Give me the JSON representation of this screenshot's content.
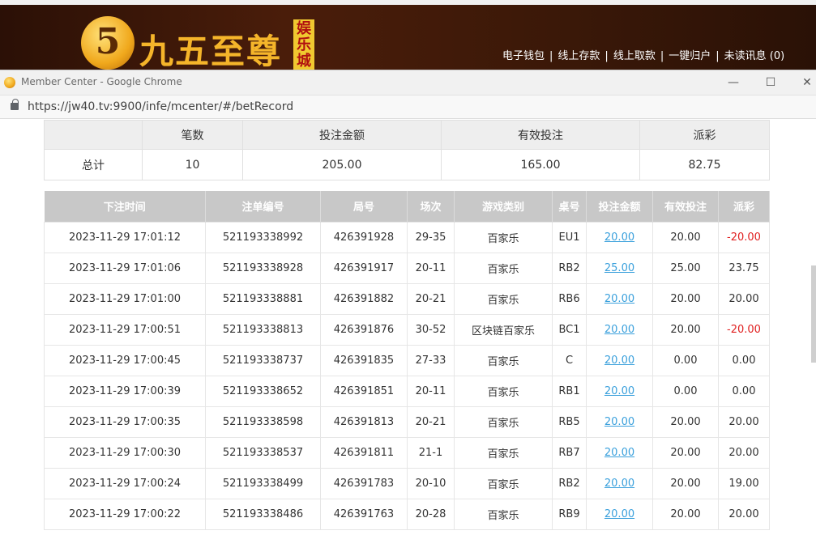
{
  "site": {
    "logo_glyph": "5",
    "logo_text": "九五至尊",
    "logo_badge": "娱乐城",
    "nav": [
      "电子钱包",
      "线上存款",
      "线上取款",
      "一键归户",
      "未读讯息 (0)"
    ],
    "nav_sep": "|"
  },
  "window": {
    "title": "Member Center - Google Chrome",
    "url": "https://jw40.tv:9900/infe/mcenter/#/betRecord",
    "min_label": "—",
    "max_label": "☐",
    "close_label": "✕"
  },
  "summary": {
    "headers": [
      "",
      "笔数",
      "投注金额",
      "有效投注",
      "派彩"
    ],
    "row": [
      "总计",
      "10",
      "205.00",
      "165.00",
      "82.75"
    ]
  },
  "records": {
    "headers": [
      "下注时间",
      "注单编号",
      "局号",
      "场次",
      "游戏类别",
      "桌号",
      "投注金额",
      "有效投注",
      "派彩"
    ],
    "rows": [
      [
        "2023-11-29 17:01:12",
        "521193338992",
        "426391928",
        "29-35",
        "百家乐",
        "EU1",
        "20.00",
        "20.00",
        "-20.00"
      ],
      [
        "2023-11-29 17:01:06",
        "521193338928",
        "426391917",
        "20-11",
        "百家乐",
        "RB2",
        "25.00",
        "25.00",
        "23.75"
      ],
      [
        "2023-11-29 17:01:00",
        "521193338881",
        "426391882",
        "20-21",
        "百家乐",
        "RB6",
        "20.00",
        "20.00",
        "20.00"
      ],
      [
        "2023-11-29 17:00:51",
        "521193338813",
        "426391876",
        "30-52",
        "区块链百家乐",
        "BC1",
        "20.00",
        "20.00",
        "-20.00"
      ],
      [
        "2023-11-29 17:00:45",
        "521193338737",
        "426391835",
        "27-33",
        "百家乐",
        "C",
        "20.00",
        "0.00",
        "0.00"
      ],
      [
        "2023-11-29 17:00:39",
        "521193338652",
        "426391851",
        "20-11",
        "百家乐",
        "RB1",
        "20.00",
        "0.00",
        "0.00"
      ],
      [
        "2023-11-29 17:00:35",
        "521193338598",
        "426391813",
        "20-21",
        "百家乐",
        "RB5",
        "20.00",
        "20.00",
        "20.00"
      ],
      [
        "2023-11-29 17:00:30",
        "521193338537",
        "426391811",
        "21-1",
        "百家乐",
        "RB7",
        "20.00",
        "20.00",
        "20.00"
      ],
      [
        "2023-11-29 17:00:24",
        "521193338499",
        "426391783",
        "20-10",
        "百家乐",
        "RB2",
        "20.00",
        "20.00",
        "19.00"
      ],
      [
        "2023-11-29 17:00:22",
        "521193338486",
        "426391763",
        "20-28",
        "百家乐",
        "RB9",
        "20.00",
        "20.00",
        "20.00"
      ]
    ]
  },
  "colors": {
    "negative": "#e02020",
    "link": "#3aa0dc",
    "header_bg": "#c8c8c8"
  }
}
